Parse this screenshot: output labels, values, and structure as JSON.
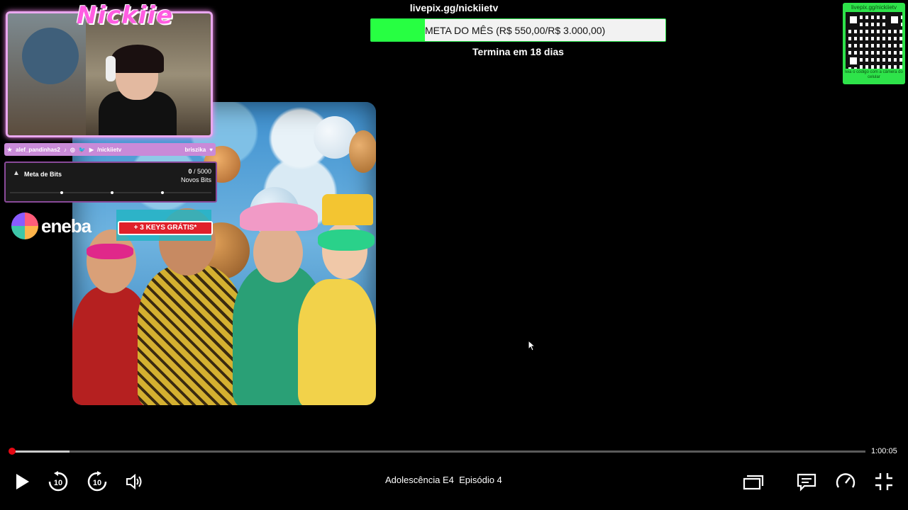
{
  "overlay": {
    "streamer_logo": "Nickiie",
    "social_bar": {
      "left_handle": "alef_pandinhas2",
      "channel": "/nickiietv",
      "right_handle": "briszika"
    },
    "bits_goal": {
      "title": "Meta de Bits",
      "current": "0",
      "total": "/ 5000",
      "subtitle": "Novos Bits",
      "progress": 0
    },
    "sponsor": {
      "name": "eneba",
      "badge": "+ 3 KEYS GRÁTIS*"
    },
    "donation_goal": {
      "url": "livepix.gg/nickiietv",
      "label": "META DO MÊS (R$ 550,00/R$ 3.000,00)",
      "progress": 0.183,
      "ends": "Termina em 18 dias"
    },
    "qr_panel": {
      "url": "livepix.gg/nickiietv",
      "hint": "leia o código com a câmera do celular"
    }
  },
  "player": {
    "elapsed_fraction": 0.068,
    "remaining_time": "1:00:05",
    "title": "Adolescência E4",
    "episode": "Episódio 4",
    "controls": [
      "play-icon",
      "rewind-10-icon",
      "forward-10-icon",
      "volume-icon",
      "episodes-icon",
      "subtitles-icon",
      "speed-icon",
      "exit-fullscreen-icon"
    ]
  },
  "colors": {
    "accent_red": "#e50914",
    "goal_green": "#27ff42",
    "overlay_pink": "#ff5ce1"
  }
}
